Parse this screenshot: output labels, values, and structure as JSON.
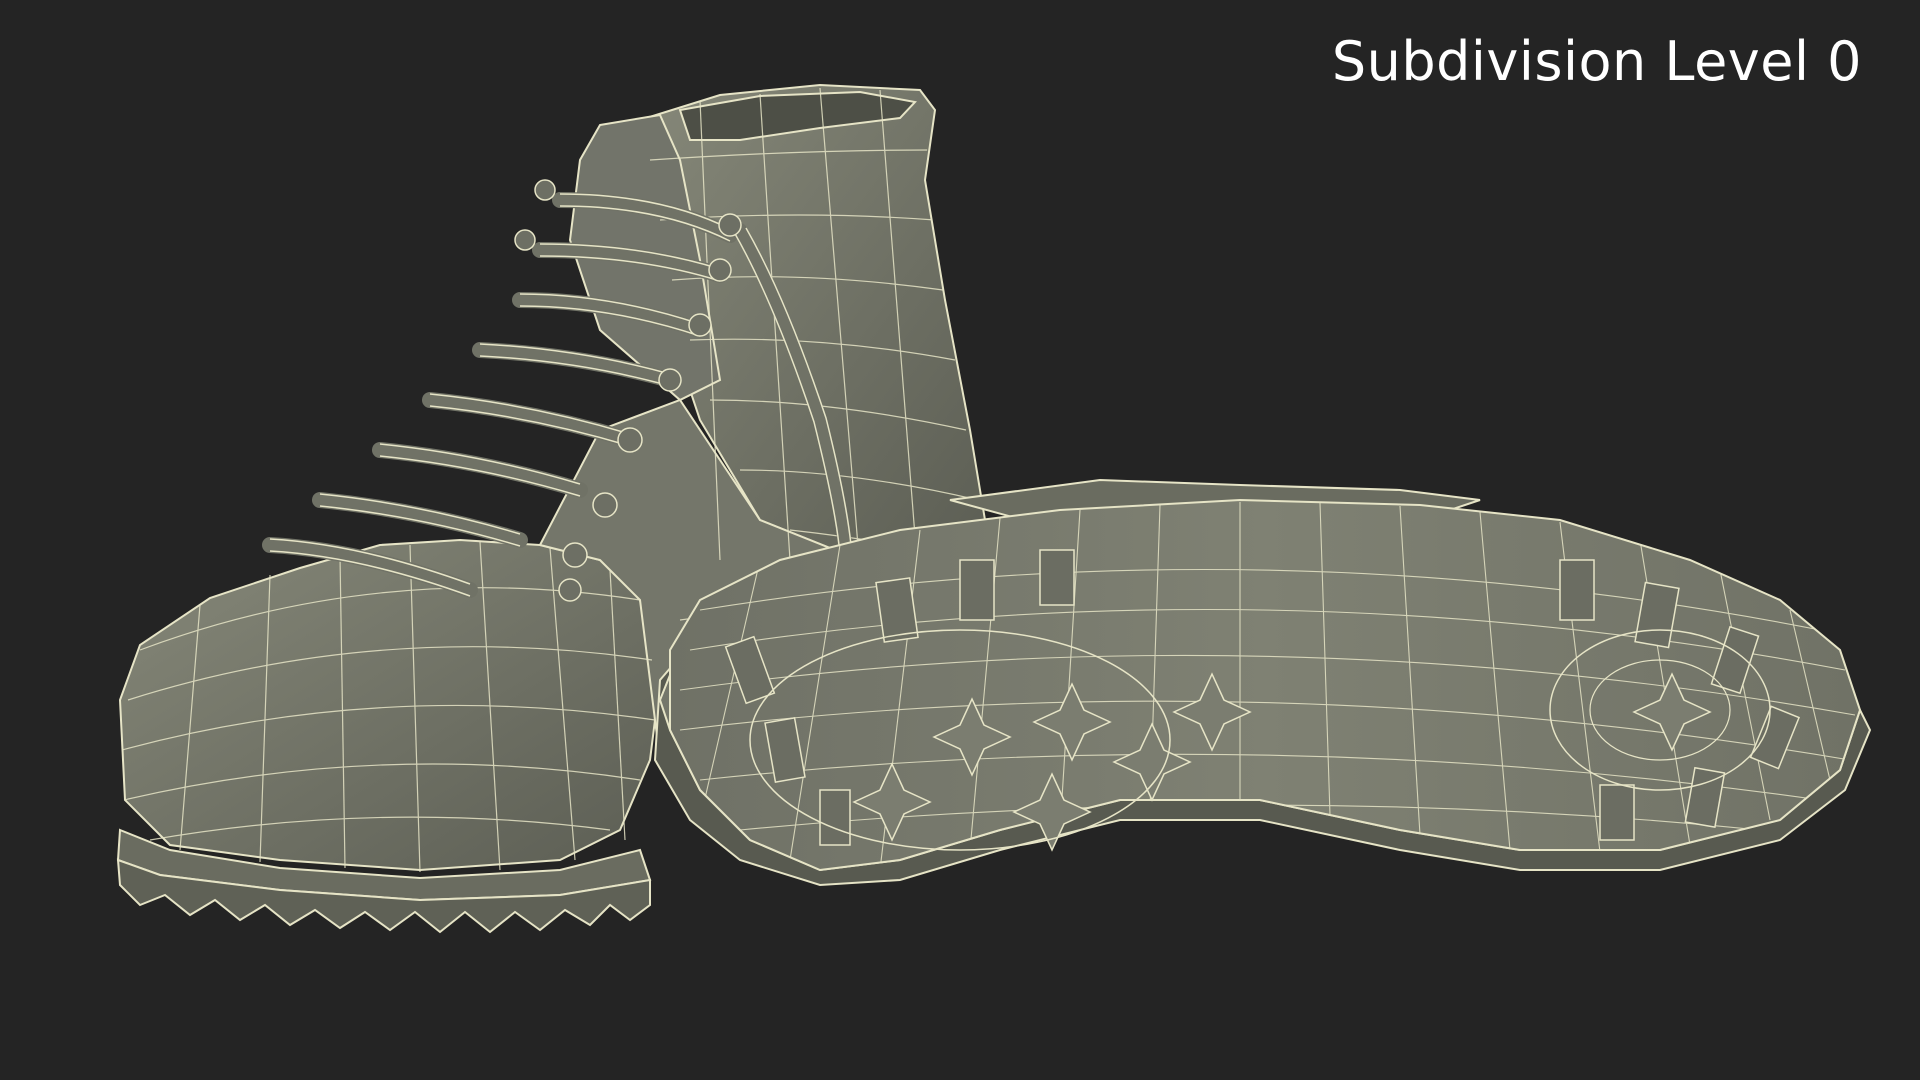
{
  "render": {
    "label": "Subdivision Level 0"
  },
  "colors": {
    "background": "#242424",
    "surface": "#7e8072",
    "surface_shadow": "#5f6156",
    "surface_dark": "#4d4f46",
    "wire": "#e6e4c6",
    "label_text": "#ffffff"
  },
  "icons": {
    "left_object": "hiking-boot-wireframe",
    "right_object": "boot-sole-wireframe"
  }
}
